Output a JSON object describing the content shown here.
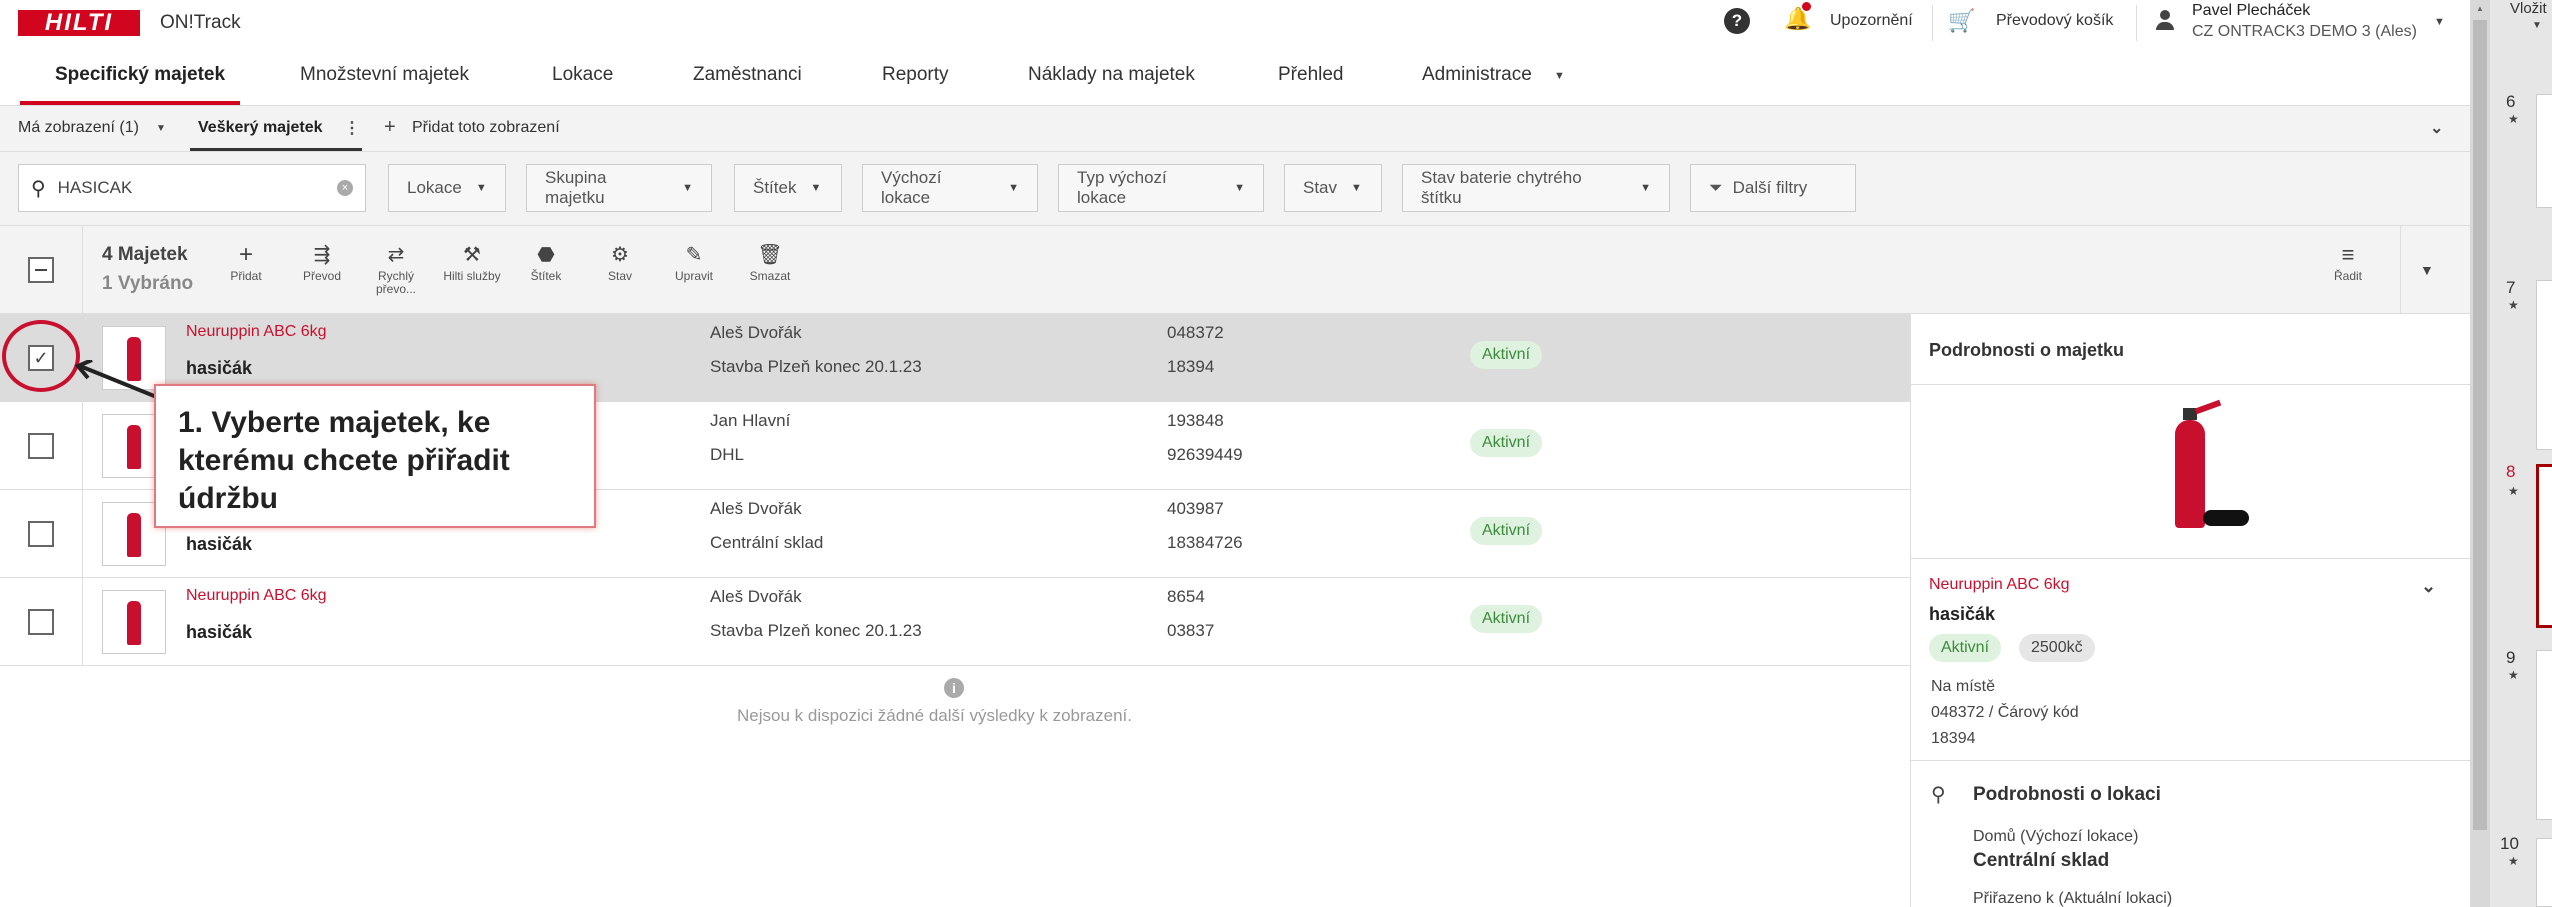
{
  "header": {
    "logo_text": "HILTI",
    "app_title": "ON!Track",
    "notifications_label": "Upozornění",
    "cart_label": "Převodový košík",
    "user_name": "Pavel Plecháček",
    "user_org": "CZ ONTRACK3 DEMO 3 (Ales)",
    "insert_label": "Vložit"
  },
  "nav": {
    "items": [
      "Specifický majetek",
      "Množstevní majetek",
      "Lokace",
      "Zaměstnanci",
      "Reporty",
      "Náklady na majetek",
      "Přehled",
      "Administrace"
    ]
  },
  "viewbar": {
    "my_views": "Má zobrazení (1)",
    "all_assets": "Veškerý majetek",
    "add_view": "Přidat toto zobrazení"
  },
  "filters": {
    "search_value": "HASICAK",
    "buttons": [
      "Lokace",
      "Skupina majetku",
      "Štítek",
      "Výchozí lokace",
      "Typ výchozí lokace",
      "Stav",
      "Stav baterie chytrého štítku"
    ],
    "more_filters": "Další filtry"
  },
  "actions": {
    "count": "4 Majetek",
    "selected": "1 Vybráno",
    "items": [
      {
        "icon": "plus-icon",
        "label": "Přidat"
      },
      {
        "icon": "transfer-icon",
        "label": "Převod"
      },
      {
        "icon": "quick-transfer-icon",
        "label": "Rychlý převo..."
      },
      {
        "icon": "hilti-services-icon",
        "label": "Hilti služby"
      },
      {
        "icon": "tag-icon",
        "label": "Štítek"
      },
      {
        "icon": "status-icon",
        "label": "Stav"
      },
      {
        "icon": "edit-icon",
        "label": "Upravit"
      },
      {
        "icon": "trash-icon",
        "label": "Smazat"
      }
    ],
    "sort_label": "Řadit"
  },
  "rows": [
    {
      "model": "Neuruppin ABC 6kg",
      "name": "hasičák",
      "person": "Aleš Dvořák",
      "location": "Stavba Plzeň konec 20.1.23",
      "num1": "048372",
      "num2": "18394",
      "status": "Aktivní",
      "selected": true
    },
    {
      "model": "",
      "name": "",
      "person": "Jan Hlavní",
      "location": "DHL",
      "num1": "193848",
      "num2": "92639449",
      "status": "Aktivní",
      "selected": false
    },
    {
      "model": "",
      "name": "hasičák",
      "person": "Aleš Dvořák",
      "location": "Centrální sklad",
      "num1": "403987",
      "num2": "18384726",
      "status": "Aktivní",
      "selected": false
    },
    {
      "model": "Neuruppin ABC 6kg",
      "name": "hasičák",
      "person": "Aleš Dvořák",
      "location": "Stavba Plzeň konec 20.1.23",
      "num1": "8654",
      "num2": "03837",
      "status": "Aktivní",
      "selected": false
    }
  ],
  "no_more_results": "Nejsou k dispozici žádné další výsledky k zobrazení.",
  "panel": {
    "title": "Podrobnosti o majetku",
    "model": "Neuruppin ABC 6kg",
    "name": "hasičák",
    "status": "Aktivní",
    "price": "2500kč",
    "on_site": "Na místě",
    "barcode_line": "048372 / Čárový kód",
    "barcode_value": "18394",
    "location_title": "Podrobnosti o lokaci",
    "home_label": "Domů (Výchozí lokace)",
    "home_value": "Centrální sklad",
    "assigned_label": "Přiřazeno k (Aktuální lokaci)"
  },
  "callout": {
    "text": "1. Vyberte majetek, ke kterému chcete přiřadit údržbu"
  },
  "slides": [
    "6",
    "7",
    "8",
    "9",
    "10"
  ],
  "colors": {
    "brand": "#d2051e",
    "active_badge": "#dff2df",
    "row_selected": "#dcdcdc"
  }
}
